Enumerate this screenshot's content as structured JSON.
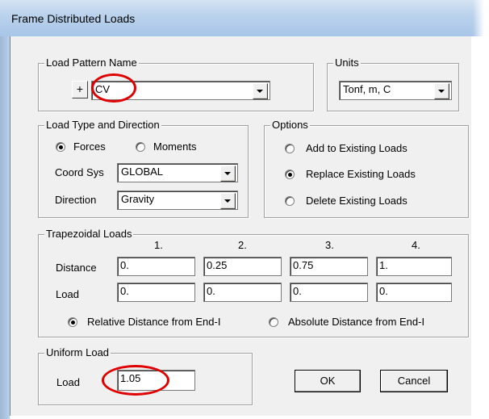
{
  "window": {
    "title": "Frame Distributed Loads"
  },
  "load_pattern": {
    "group_label": "Load Pattern Name",
    "add_button_label": "+",
    "selected": "CV"
  },
  "units": {
    "group_label": "Units",
    "selected": "Tonf, m, C"
  },
  "load_type": {
    "group_label": "Load Type and Direction",
    "forces_label": "Forces",
    "moments_label": "Moments",
    "selected": "Forces",
    "coord_sys_label": "Coord Sys",
    "coord_sys_value": "GLOBAL",
    "direction_label": "Direction",
    "direction_value": "Gravity"
  },
  "options": {
    "group_label": "Options",
    "items": [
      "Add to Existing Loads",
      "Replace Existing Loads",
      "Delete Existing Loads"
    ],
    "selected": "Replace Existing Loads"
  },
  "trapezoidal": {
    "group_label": "Trapezoidal Loads",
    "columns": [
      "1.",
      "2.",
      "3.",
      "4."
    ],
    "distance_label": "Distance",
    "distances": [
      "0.",
      "0.25",
      "0.75",
      "1."
    ],
    "load_label": "Load",
    "loads": [
      "0.",
      "0.",
      "0.",
      "0."
    ],
    "relative_label": "Relative Distance from End-I",
    "absolute_label": "Absolute Distance from End-I",
    "selected": "Relative Distance from End-I"
  },
  "uniform": {
    "group_label": "Uniform Load",
    "load_label": "Load",
    "load_value": "1.05"
  },
  "buttons": {
    "ok": "OK",
    "cancel": "Cancel"
  },
  "colors": {
    "highlight_ring": "#e00000",
    "titlebar": "#b9d1ec",
    "dialog_bg": "#f0f0f0"
  }
}
